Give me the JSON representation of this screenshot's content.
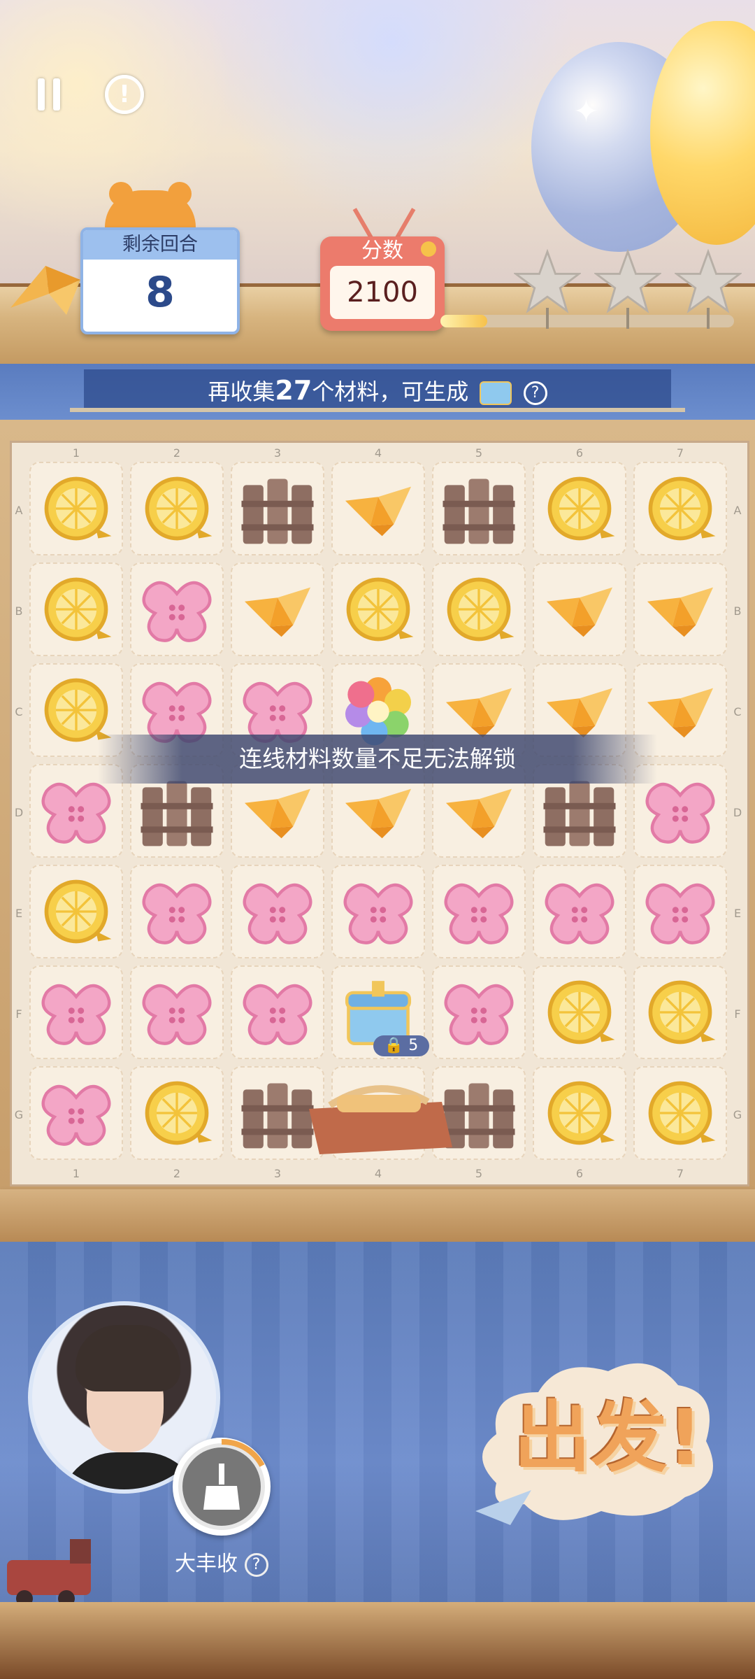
{
  "hud": {
    "pause_icon": "pause-icon",
    "info_icon": "exclamation-icon",
    "moves_label": "剩余回合",
    "moves_value": "8",
    "score_label": "分数",
    "score_value": "2100",
    "score_progress": 0.16,
    "stars": 3
  },
  "goal": {
    "prefix": "再收集",
    "count": "27",
    "suffix": "个材料，可生成",
    "reward_icon": "chest-icon",
    "help_icon": "question-icon"
  },
  "board": {
    "col_labels": [
      "1",
      "2",
      "3",
      "4",
      "5",
      "6",
      "7"
    ],
    "row_labels": [
      "A",
      "B",
      "C",
      "D",
      "E",
      "F",
      "G"
    ],
    "grid": [
      [
        "lemon",
        "lemon",
        "fence",
        "crane",
        "fence",
        "lemon",
        "lemon"
      ],
      [
        "lemon",
        "button",
        "crane",
        "lemon",
        "lemon",
        "crane",
        "crane"
      ],
      [
        "lemon",
        "button",
        "button",
        "rainbow",
        "crane",
        "crane",
        "crane"
      ],
      [
        "button",
        "fence",
        "crane",
        "crane",
        "crane",
        "fence",
        "button"
      ],
      [
        "lemon",
        "button",
        "button",
        "button",
        "button",
        "button",
        "button"
      ],
      [
        "button",
        "button",
        "button",
        "chest",
        "button",
        "lemon",
        "lemon"
      ],
      [
        "button",
        "lemon",
        "fence",
        "bag",
        "fence",
        "lemon",
        "lemon"
      ]
    ],
    "lock_count": "5",
    "toast": "连线材料数量不足无法解锁"
  },
  "bottom": {
    "skill_label": "大丰收",
    "skill_help": "?",
    "go_label": "出发!"
  },
  "colors": {
    "lemon": "#f7cf4a",
    "button": "#f3a6c6",
    "crane": "#f7b23f",
    "fence": "#8e6e62",
    "banner": "#3e5f9f"
  }
}
